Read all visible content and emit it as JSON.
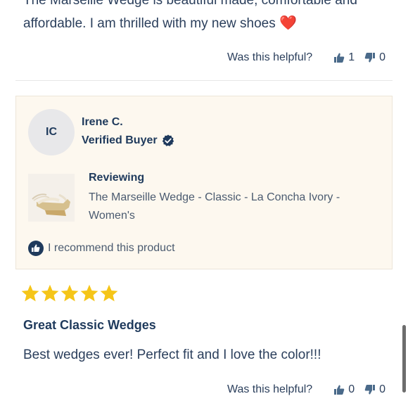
{
  "previous_review": {
    "line1": "The Marseille Wedge is beautiful made, comfortable and",
    "line2": "affordable. I am thrilled with my new shoes",
    "emoji": "❤️",
    "helpful_question": "Was this helpful?",
    "upvotes": "1",
    "downvotes": "0"
  },
  "review": {
    "avatar_initials": "IC",
    "reviewer_name": "Irene C.",
    "verified_label": "Verified Buyer",
    "reviewing_label": "Reviewing",
    "product_name": "The Marseille Wedge - Classic - La Concha Ivory - Women's",
    "recommend_text": "I recommend this product",
    "rating": 5,
    "title": "Great Classic Wedges",
    "body": "Best wedges ever! Perfect fit and I love the color!!!",
    "helpful_question": "Was this helpful?",
    "upvotes": "0",
    "downvotes": "0"
  },
  "colors": {
    "navy": "#1f3a5c",
    "star": "#f5c518",
    "card_bg": "#fdf8ef"
  },
  "icons": [
    "thumbs-up-icon",
    "thumbs-down-icon",
    "verified-check-icon",
    "recommend-thumb-icon",
    "star-icon",
    "heart-emoji"
  ]
}
